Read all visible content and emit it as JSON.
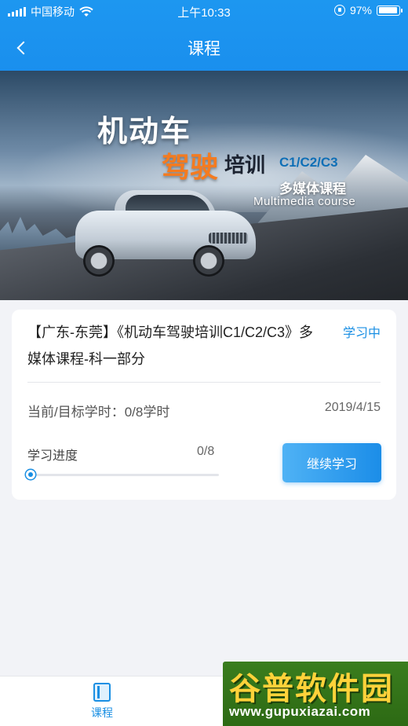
{
  "status_bar": {
    "carrier": "中国移动",
    "time": "上午10:33",
    "battery": "97%",
    "battery_level": 0.97
  },
  "nav": {
    "title": "课程"
  },
  "banner": {
    "line1": "机动车",
    "line2_highlight": "驾驶",
    "line2_rest": "培训",
    "line2_classes": "C1/C2/C3",
    "line3": "多媒体课程",
    "line4": "Multimedia course"
  },
  "course": {
    "title": "【广东-东莞】《机动车驾驶培训C1/C2/C3》多媒体课程-科一部分",
    "status": "学习中",
    "hours": "当前/目标学时：0/8学时",
    "date": "2019/4/15",
    "progress_label": "学习进度",
    "progress_value": "0/8",
    "progress_fraction": 0,
    "continue_label": "继续学习"
  },
  "tabbar": {
    "tabs": [
      {
        "label": "课程",
        "icon": "book-icon",
        "active": true
      }
    ]
  },
  "watermark": {
    "main": "谷普软件园",
    "url": "www.gupuxiazai.com"
  },
  "colors": {
    "accent": "#1a8fe3",
    "header": "#1d97f0",
    "banner_orange": "#f47b20"
  }
}
